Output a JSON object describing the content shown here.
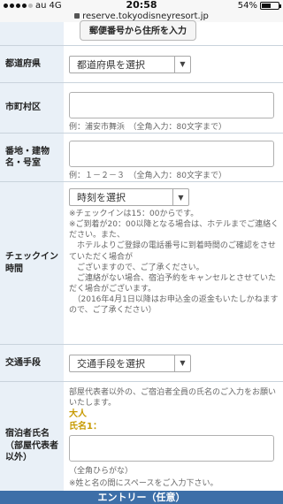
{
  "status_bar": {
    "carrier": "au",
    "network": "4G",
    "time": "20:58",
    "battery": "54%",
    "battery_level": 0.54
  },
  "url_bar": {
    "domain": "reserve.tokyodisneyresort.jp"
  },
  "zip_button": {
    "label": "郵便番号から住所を入力"
  },
  "prefecture": {
    "label": "都道府県",
    "select_value": "都道府県を選択"
  },
  "city": {
    "label": "市町村区",
    "value": "",
    "hint": "例：浦安市舞浜　（全角入力：80文字まで）"
  },
  "address": {
    "label": "番地・建物名・号室",
    "value": "",
    "hint": "例：１－２－３　（全角入力：80文字まで）"
  },
  "checkin": {
    "label": "チェックイン時間",
    "select_value": "時刻を選択",
    "notes": [
      "※チェックインは15：00からです。",
      "※ご到着が20：00以降となる場合は、ホテルまでご連絡ください。また、",
      "　ホテルよりご登録の電話番号に到着時間のご確認をさせていただく場合が",
      "　ございますので、ご了承ください。",
      "　ご連絡がない場合、宿泊予約をキャンセルとさせていただく場合がございます。",
      "　（2016年4月1日以降はお申込金の返金もいたしかねますので、ご了承ください）"
    ]
  },
  "transport": {
    "label": "交通手段",
    "select_value": "交通手段を選択"
  },
  "guests": {
    "label": "宿泊者氏名（部屋代表者以外）",
    "intro": "部屋代表者以外の、ご宿泊者全員の氏名のご入力をお願いいたします。",
    "adult_label": "大人",
    "name_label": "氏名1：",
    "name_value": "",
    "hint": "（全角ひらがな）",
    "note": "※姓と名の間にスペースをご入力下さい。"
  },
  "submit": {
    "label": "エントリー（任意）"
  }
}
